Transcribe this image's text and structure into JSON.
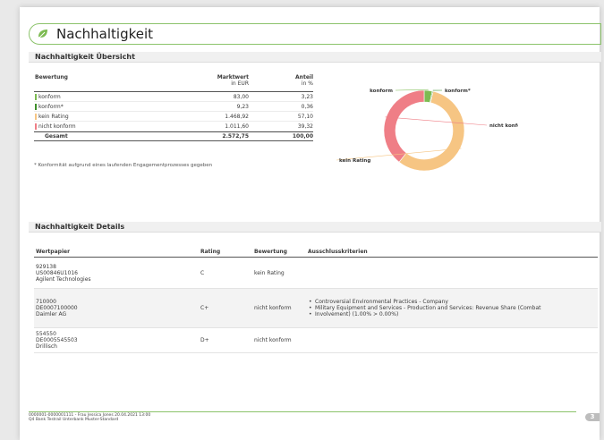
{
  "title": "Nachhaltigkeit",
  "overview": {
    "heading": "Nachhaltigkeit Übersicht",
    "col_bewertung": "Bewertung",
    "col_marktwert": "Marktwert",
    "col_marktwert_unit": "in EUR",
    "col_anteil": "Anteil",
    "col_anteil_unit": "in %",
    "rows": [
      {
        "label": "konform",
        "marktwert": "83,00",
        "anteil": "3,23",
        "color": "#7dbb52"
      },
      {
        "label": "konform*",
        "marktwert": "9,23",
        "anteil": "0,36",
        "color": "#3f8f2a"
      },
      {
        "label": "kein Rating",
        "marktwert": "1.468,92",
        "anteil": "57,10",
        "color": "#f6c583"
      },
      {
        "label": "nicht konform",
        "marktwert": "1.011,60",
        "anteil": "39,32",
        "color": "#ef7e86"
      }
    ],
    "total": {
      "label": "Gesamt",
      "marktwert": "2.572,75",
      "anteil": "100,00"
    },
    "footnote": "* Konformität aufgrund eines laufenden Engagementprozesses gegeben"
  },
  "chart_data": {
    "type": "pie",
    "categories": [
      "konform",
      "konform*",
      "kein Rating",
      "nicht konform"
    ],
    "values": [
      3.23,
      0.36,
      57.1,
      39.32
    ],
    "colors": [
      "#7dbb52",
      "#3f8f2a",
      "#f6c583",
      "#ef7e86"
    ],
    "donut": true
  },
  "details": {
    "heading": "Nachhaltigkeit Details",
    "col_wertpapier": "Wertpapier",
    "col_rating": "Rating",
    "col_bewertung": "Bewertung",
    "col_ausschluss": "Ausschlusskriterien",
    "rows": [
      {
        "nr": "929138",
        "isin": "US00846U1016",
        "name": "Agilent Technologies",
        "rating": "C",
        "bewertung": "kein Rating",
        "kriterien": []
      },
      {
        "nr": "710000",
        "isin": "DE0007100000",
        "name": "Daimler AG",
        "rating": "C+",
        "bewertung": "nicht konform",
        "kriterien": [
          "Controversial Environmental Practices - Company",
          "Military Equipment and Services - Production and Services: Revenue Share (Combat",
          "Involvement) (1.00% > 0.00%)"
        ]
      },
      {
        "nr": "554550",
        "isin": "DE0005545503",
        "name": "Drillisch",
        "rating": "D+",
        "bewertung": "nicht konform",
        "kriterien": []
      }
    ]
  },
  "footer": {
    "line1": "0000001-0000001111 - Frau Jessica Jones 20.04.2021 13:00",
    "line2": "Q4 Bank Testrail Unterbank Muster-Standard",
    "page": "3"
  }
}
